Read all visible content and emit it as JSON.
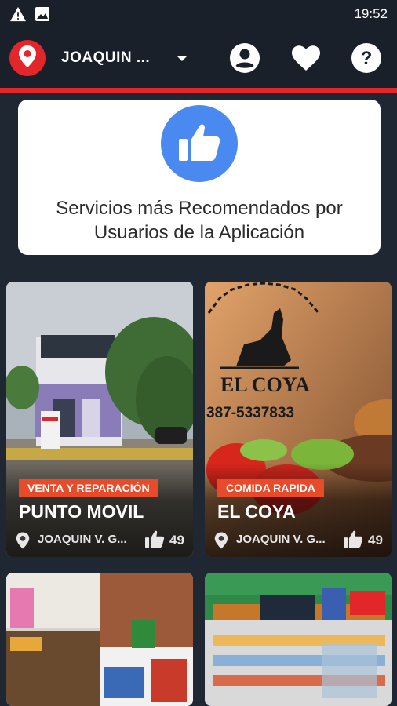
{
  "status_bar": {
    "time": "19:52",
    "icons": [
      "warning-icon",
      "image-icon"
    ]
  },
  "header": {
    "location": "JOAQUIN ...",
    "icons": [
      "location-pin-icon",
      "dropdown-caret-icon",
      "account-icon",
      "heart-icon",
      "help-icon"
    ]
  },
  "banner": {
    "text": "Servicios más Recomendados por Usuarios de la Aplicación",
    "icon": "thumbs-up-icon",
    "accent": "#4a89ef"
  },
  "cards": [
    {
      "category": "VENTA Y REPARACIÓN",
      "name": "PUNTO MOVIL",
      "location": "JOAQUIN V. G...",
      "likes": "49"
    },
    {
      "category": "COMIDA RAPIDA",
      "name": "EL COYA",
      "location": "JOAQUIN V. G...",
      "likes": "49",
      "image_text": {
        "brand": "EL COYA",
        "phone": "387-5337833"
      }
    },
    {
      "category": "",
      "name": "",
      "location": "",
      "likes": ""
    },
    {
      "category": "",
      "name": "",
      "location": "",
      "likes": ""
    }
  ],
  "colors": {
    "brand_red": "#e3262a",
    "tag_orange": "#e74b2a",
    "background": "#1f2733"
  }
}
